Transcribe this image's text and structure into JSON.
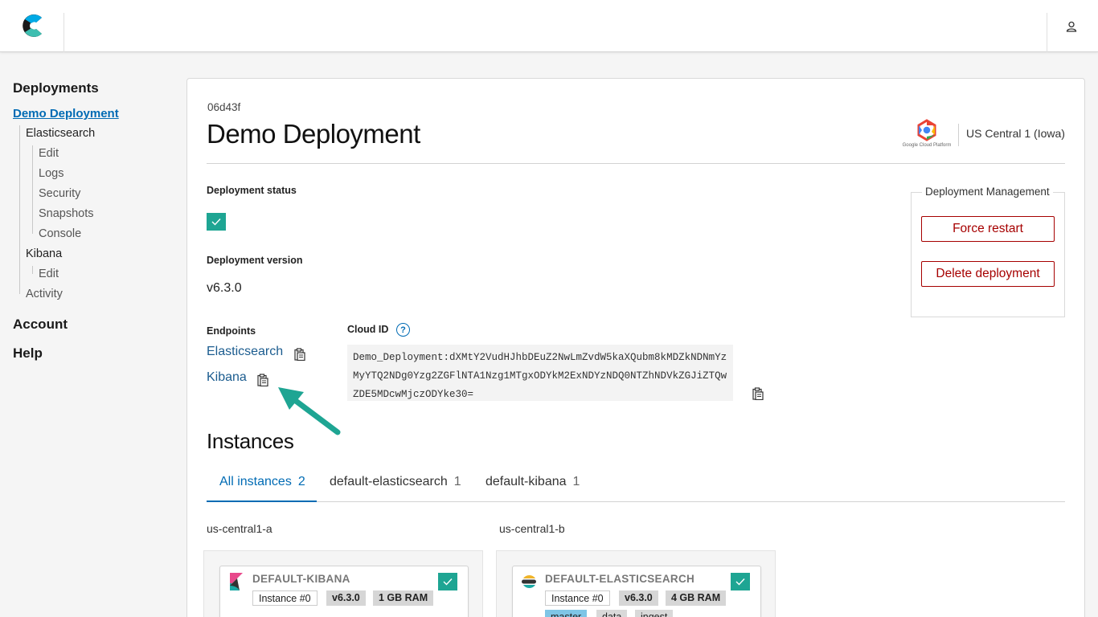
{
  "sidebar": {
    "deployments": "Deployments",
    "active": "Demo Deployment",
    "items": {
      "elasticsearch": "Elasticsearch",
      "es_edit": "Edit",
      "logs": "Logs",
      "security": "Security",
      "snapshots": "Snapshots",
      "console": "Console",
      "kibana": "Kibana",
      "kb_edit": "Edit",
      "activity": "Activity"
    },
    "account": "Account",
    "help": "Help"
  },
  "deployment": {
    "id": "06d43f",
    "title": "Demo Deployment",
    "provider_text": "Google Cloud Platform",
    "region": "US Central 1 (Iowa)",
    "status_label": "Deployment status",
    "version_label": "Deployment version",
    "version": "v6.3.0"
  },
  "management": {
    "title": "Deployment Management",
    "force_restart": "Force restart",
    "delete": "Delete deployment"
  },
  "endpoints": {
    "label": "Endpoints",
    "elasticsearch": "Elasticsearch",
    "kibana": "Kibana",
    "cloud_id_label": "Cloud ID",
    "help_glyph": "?",
    "cloud_id": "Demo_Deployment:dXMtY2VudHJhbDEuZ2NwLmZvdW5kaXQubm8kMDZkNDNmYzMyYTQ2NDg0Yzg2ZGFlNTA1Nzg1MTgxODYkM2ExNDYzNDQ0NTZhNDVkZGJiZTQwZDE5MDcwMjczODYke30="
  },
  "instances": {
    "title": "Instances",
    "tabs": [
      {
        "label": "All instances",
        "count": "2"
      },
      {
        "label": "default-elasticsearch",
        "count": "1"
      },
      {
        "label": "default-kibana",
        "count": "1"
      }
    ],
    "zones": [
      "us-central1-a",
      "us-central1-b"
    ],
    "kibana_card": {
      "name": "DEFAULT-KIBANA",
      "instance": "Instance #0",
      "version": "v6.3.0",
      "ram": "1 GB RAM"
    },
    "es_card": {
      "name": "DEFAULT-ELASTICSEARCH",
      "instance": "Instance #0",
      "version": "v6.3.0",
      "ram": "4 GB RAM",
      "roles": [
        "master",
        "data",
        "ingest"
      ]
    }
  },
  "colors": {
    "accent": "#006bb4",
    "success": "#1ea593",
    "danger": "#a60000",
    "arrow": "#1ea593"
  }
}
